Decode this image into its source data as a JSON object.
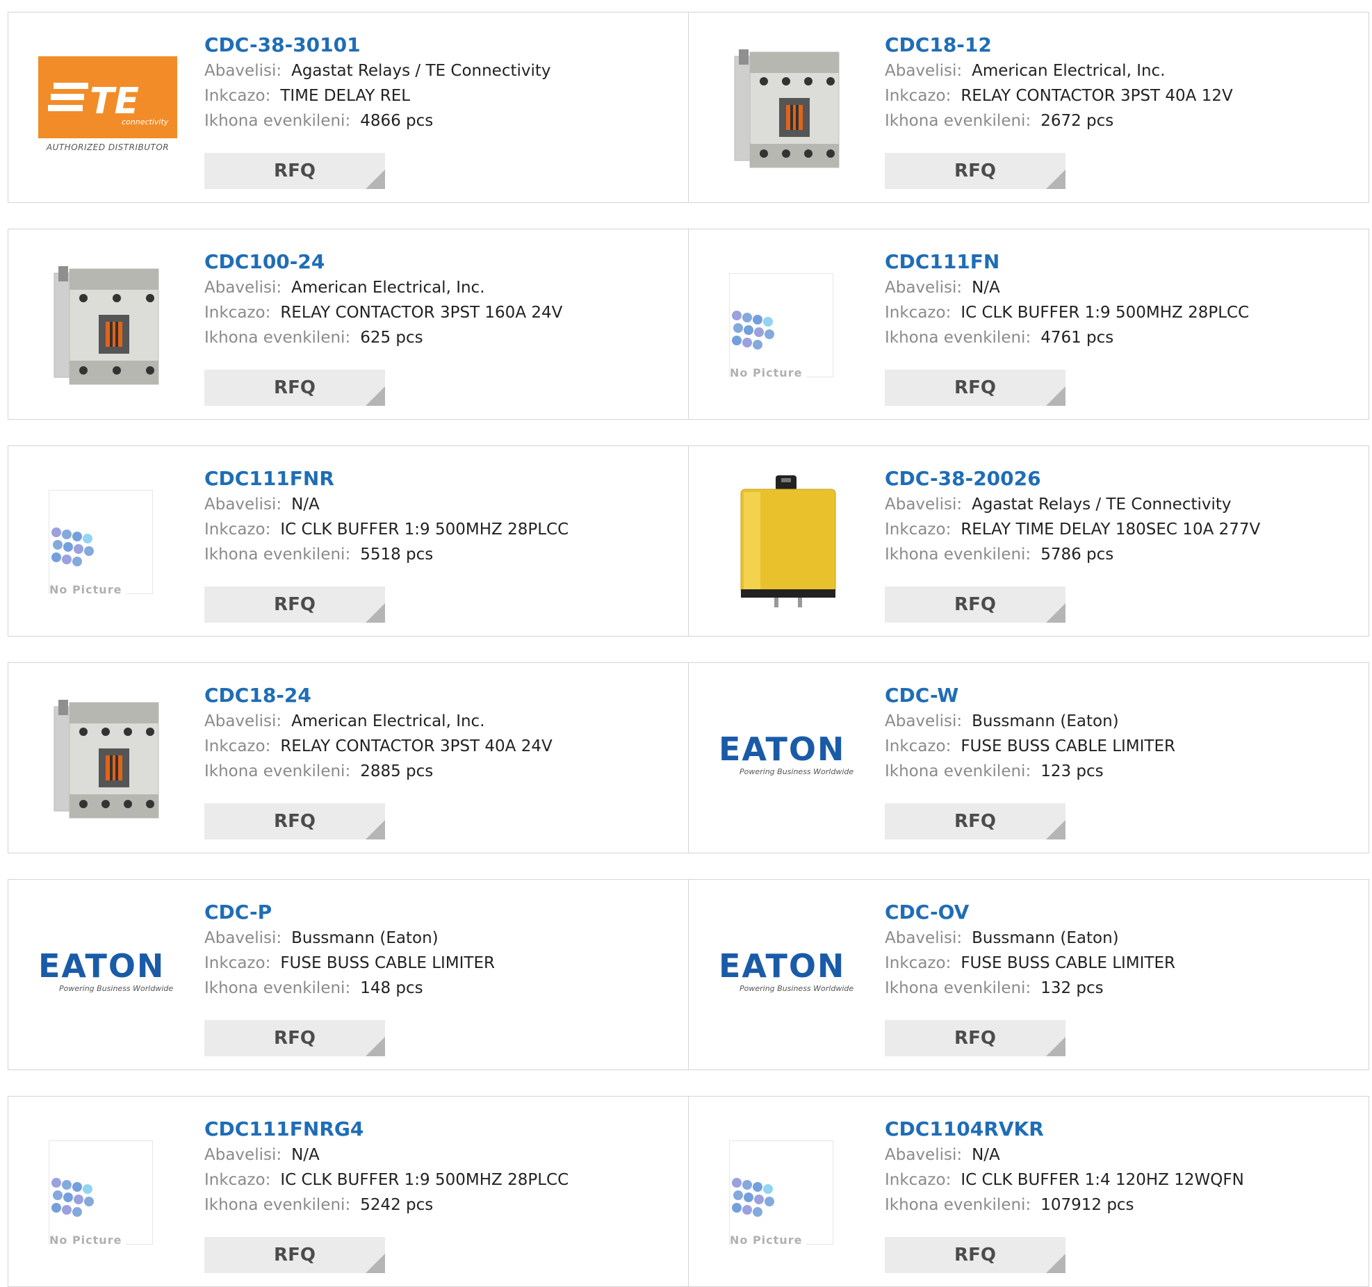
{
  "labels": {
    "manufacturer": "Abavelisi:",
    "description": "Inkcazo:",
    "stock": "Ikhona evenkileni:",
    "rfq": "RFQ",
    "no_picture": "No Picture",
    "te_caption": "AUTHORIZED DISTRIBUTOR",
    "te_sub": "connectivity",
    "eaton_tagline": "Powering Business Worldwide"
  },
  "products": [
    {
      "part": "CDC-38-30101",
      "manufacturer": "Agastat Relays / TE Connectivity",
      "description": "TIME DELAY REL",
      "stock": "4866 pcs",
      "image": "te-logo"
    },
    {
      "part": "CDC18-12",
      "manufacturer": "American Electrical, Inc.",
      "description": "RELAY CONTACTOR 3PST 40A 12V",
      "stock": "2672 pcs",
      "image": "contactor-4"
    },
    {
      "part": "CDC100-24",
      "manufacturer": "American Electrical, Inc.",
      "description": "RELAY CONTACTOR 3PST 160A 24V",
      "stock": "625 pcs",
      "image": "contactor-3"
    },
    {
      "part": "CDC111FN",
      "manufacturer": "N/A",
      "description": "IC CLK BUFFER 1:9 500MHZ 28PLCC",
      "stock": "4761 pcs",
      "image": "no-picture"
    },
    {
      "part": "CDC111FNR",
      "manufacturer": "N/A",
      "description": "IC CLK BUFFER 1:9 500MHZ 28PLCC",
      "stock": "5518 pcs",
      "image": "no-picture"
    },
    {
      "part": "CDC-38-20026",
      "manufacturer": "Agastat Relays / TE Connectivity",
      "description": "RELAY TIME DELAY 180SEC 10A 277V",
      "stock": "5786 pcs",
      "image": "yellow-relay"
    },
    {
      "part": "CDC18-24",
      "manufacturer": "American Electrical, Inc.",
      "description": "RELAY CONTACTOR 3PST 40A 24V",
      "stock": "2885 pcs",
      "image": "contactor-4"
    },
    {
      "part": "CDC-W",
      "manufacturer": "Bussmann (Eaton)",
      "description": "FUSE BUSS CABLE LIMITER",
      "stock": "123 pcs",
      "image": "eaton-logo"
    },
    {
      "part": "CDC-P",
      "manufacturer": "Bussmann (Eaton)",
      "description": "FUSE BUSS CABLE LIMITER",
      "stock": "148 pcs",
      "image": "eaton-logo"
    },
    {
      "part": "CDC-OV",
      "manufacturer": "Bussmann (Eaton)",
      "description": "FUSE BUSS CABLE LIMITER",
      "stock": "132 pcs",
      "image": "eaton-logo"
    },
    {
      "part": "CDC111FNRG4",
      "manufacturer": "N/A",
      "description": "IC CLK BUFFER 1:9 500MHZ 28PLCC",
      "stock": "5242 pcs",
      "image": "no-picture"
    },
    {
      "part": "CDC1104RVKR",
      "manufacturer": "N/A",
      "description": "IC CLK BUFFER 1:4 120HZ 12WQFN",
      "stock": "107912 pcs",
      "image": "no-picture"
    }
  ],
  "colors": {
    "part_link": "#1f6db6",
    "label": "#8a8a8a",
    "border": "#d4d4d4",
    "button_bg": "#ebebeb",
    "te_orange": "#f28c28",
    "eaton_blue": "#1a5ba8"
  }
}
